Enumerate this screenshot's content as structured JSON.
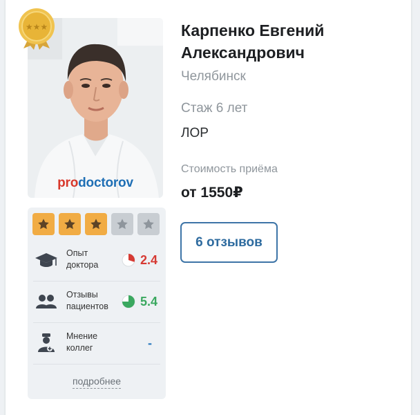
{
  "doctor": {
    "name": "Карпенко Евгений Александрович",
    "city": "Челябинск",
    "experience": "Стаж 6 лет",
    "specialty": "ЛОР",
    "price_label": "Стоимость приёма",
    "price": "от 1550₽",
    "photo_logo_pro": "pro",
    "photo_logo_rest": "doctorov"
  },
  "rating": {
    "stars_filled": 3,
    "stars_total": 5
  },
  "metrics": [
    {
      "label_line1": "Опыт",
      "label_line2": "доктора",
      "score": "2.4",
      "score_color": "#d63a33",
      "pie_fraction": 0.3,
      "pie_color": "#d63a33",
      "icon": "graduation-cap-icon"
    },
    {
      "label_line1": "Отзывы",
      "label_line2": "пациентов",
      "score": "5.4",
      "score_color": "#3aa85f",
      "pie_fraction": 0.75,
      "pie_color": "#3aa85f",
      "icon": "patients-group-icon"
    },
    {
      "label_line1": "Мнение",
      "label_line2": "коллег",
      "score": "-",
      "score_color": "#2e7bbf",
      "icon": "doctor-colleague-icon"
    }
  ],
  "more_label": "подробнее",
  "reviews_button": "6 отзывов",
  "colors": {
    "star_on": "#f1ac44",
    "star_off": "#c8cdd2",
    "accent": "#3d74a7"
  }
}
